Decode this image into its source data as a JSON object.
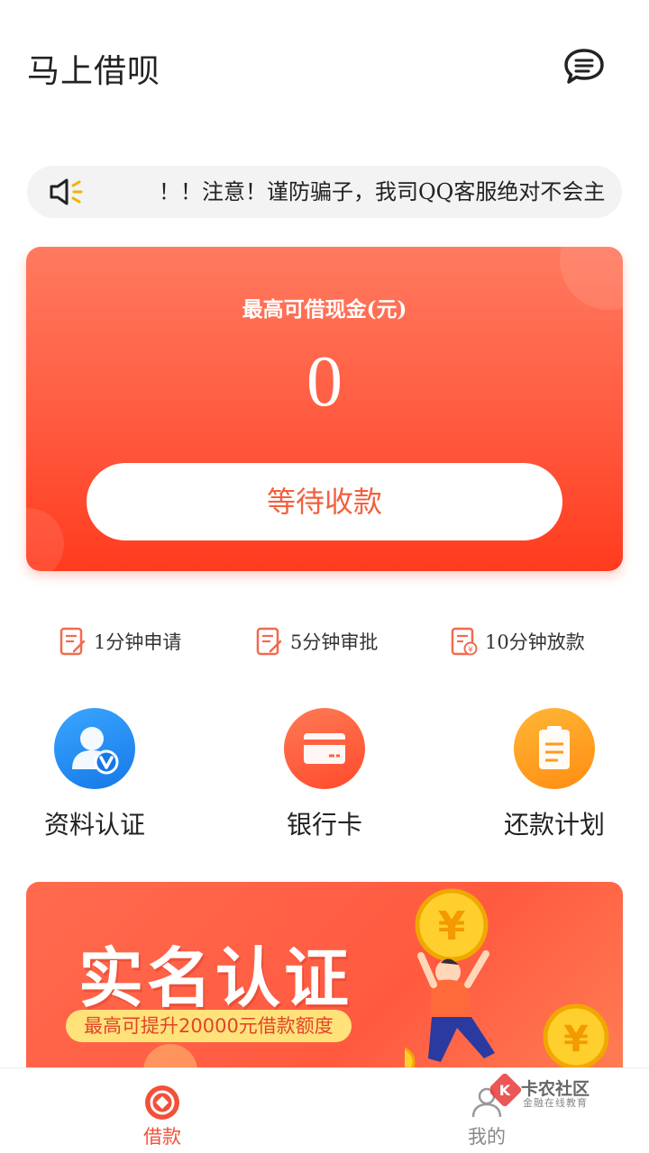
{
  "header": {
    "title": "马上借呗",
    "message_icon": "chat-bubble-icon"
  },
  "notice": {
    "icon": "speaker-icon",
    "text": "！！注意！谨防骗子，我司QQ客服绝对不会主"
  },
  "loan_card": {
    "label": "最高可借现金(元)",
    "amount": "0",
    "button_label": "等待收款"
  },
  "steps": [
    {
      "icon": "form-icon",
      "label": "1分钟申请"
    },
    {
      "icon": "form-edit-icon",
      "label": "5分钟审批"
    },
    {
      "icon": "form-yuan-icon",
      "label": "10分钟放款"
    }
  ],
  "actions": [
    {
      "icon": "user-verified-icon",
      "label": "资料认证",
      "color": "#1e8ef5"
    },
    {
      "icon": "bank-card-icon",
      "label": "银行卡",
      "color": "#ff5a3c"
    },
    {
      "icon": "clipboard-icon",
      "label": "还款计划",
      "color": "#ff9a1e"
    }
  ],
  "banner": {
    "title": "实名认证",
    "subtitle": "最高可提升20000元借款额度"
  },
  "tabbar": {
    "tabs": [
      {
        "icon": "borrow-icon",
        "label": "借款",
        "active": true
      },
      {
        "icon": "profile-icon",
        "label": "我的",
        "active": false
      }
    ]
  },
  "watermark": {
    "title": "卡农社区",
    "subtitle": "金融在线教育"
  },
  "colors": {
    "accent": "#ff4d2e",
    "active_tab": "#f2503a",
    "inactive_tab": "#888888"
  }
}
